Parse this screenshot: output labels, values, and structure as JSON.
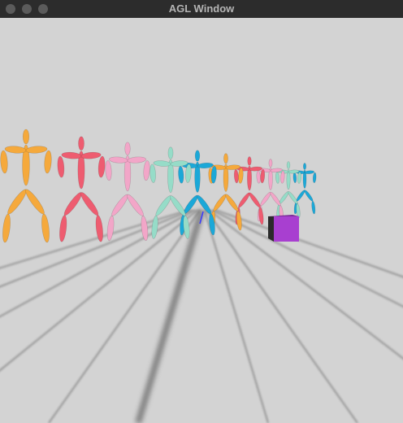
{
  "window": {
    "title": "AGL Window",
    "traffic_lights": [
      "close-button",
      "minimize-button",
      "zoom-button"
    ]
  },
  "scene": {
    "background": "#d3d3d3",
    "grid_color": "#5a5a5a",
    "figure_count": 10,
    "figure_colors": [
      "#f5a93c",
      "#ee5c70",
      "#f2a6c8",
      "#96dcc8",
      "#1ba8d8",
      "#f5a93c",
      "#ee5c70",
      "#f2a6c8",
      "#96dcc8",
      "#1ba8d8"
    ],
    "cube_color": "#a83fd0"
  }
}
